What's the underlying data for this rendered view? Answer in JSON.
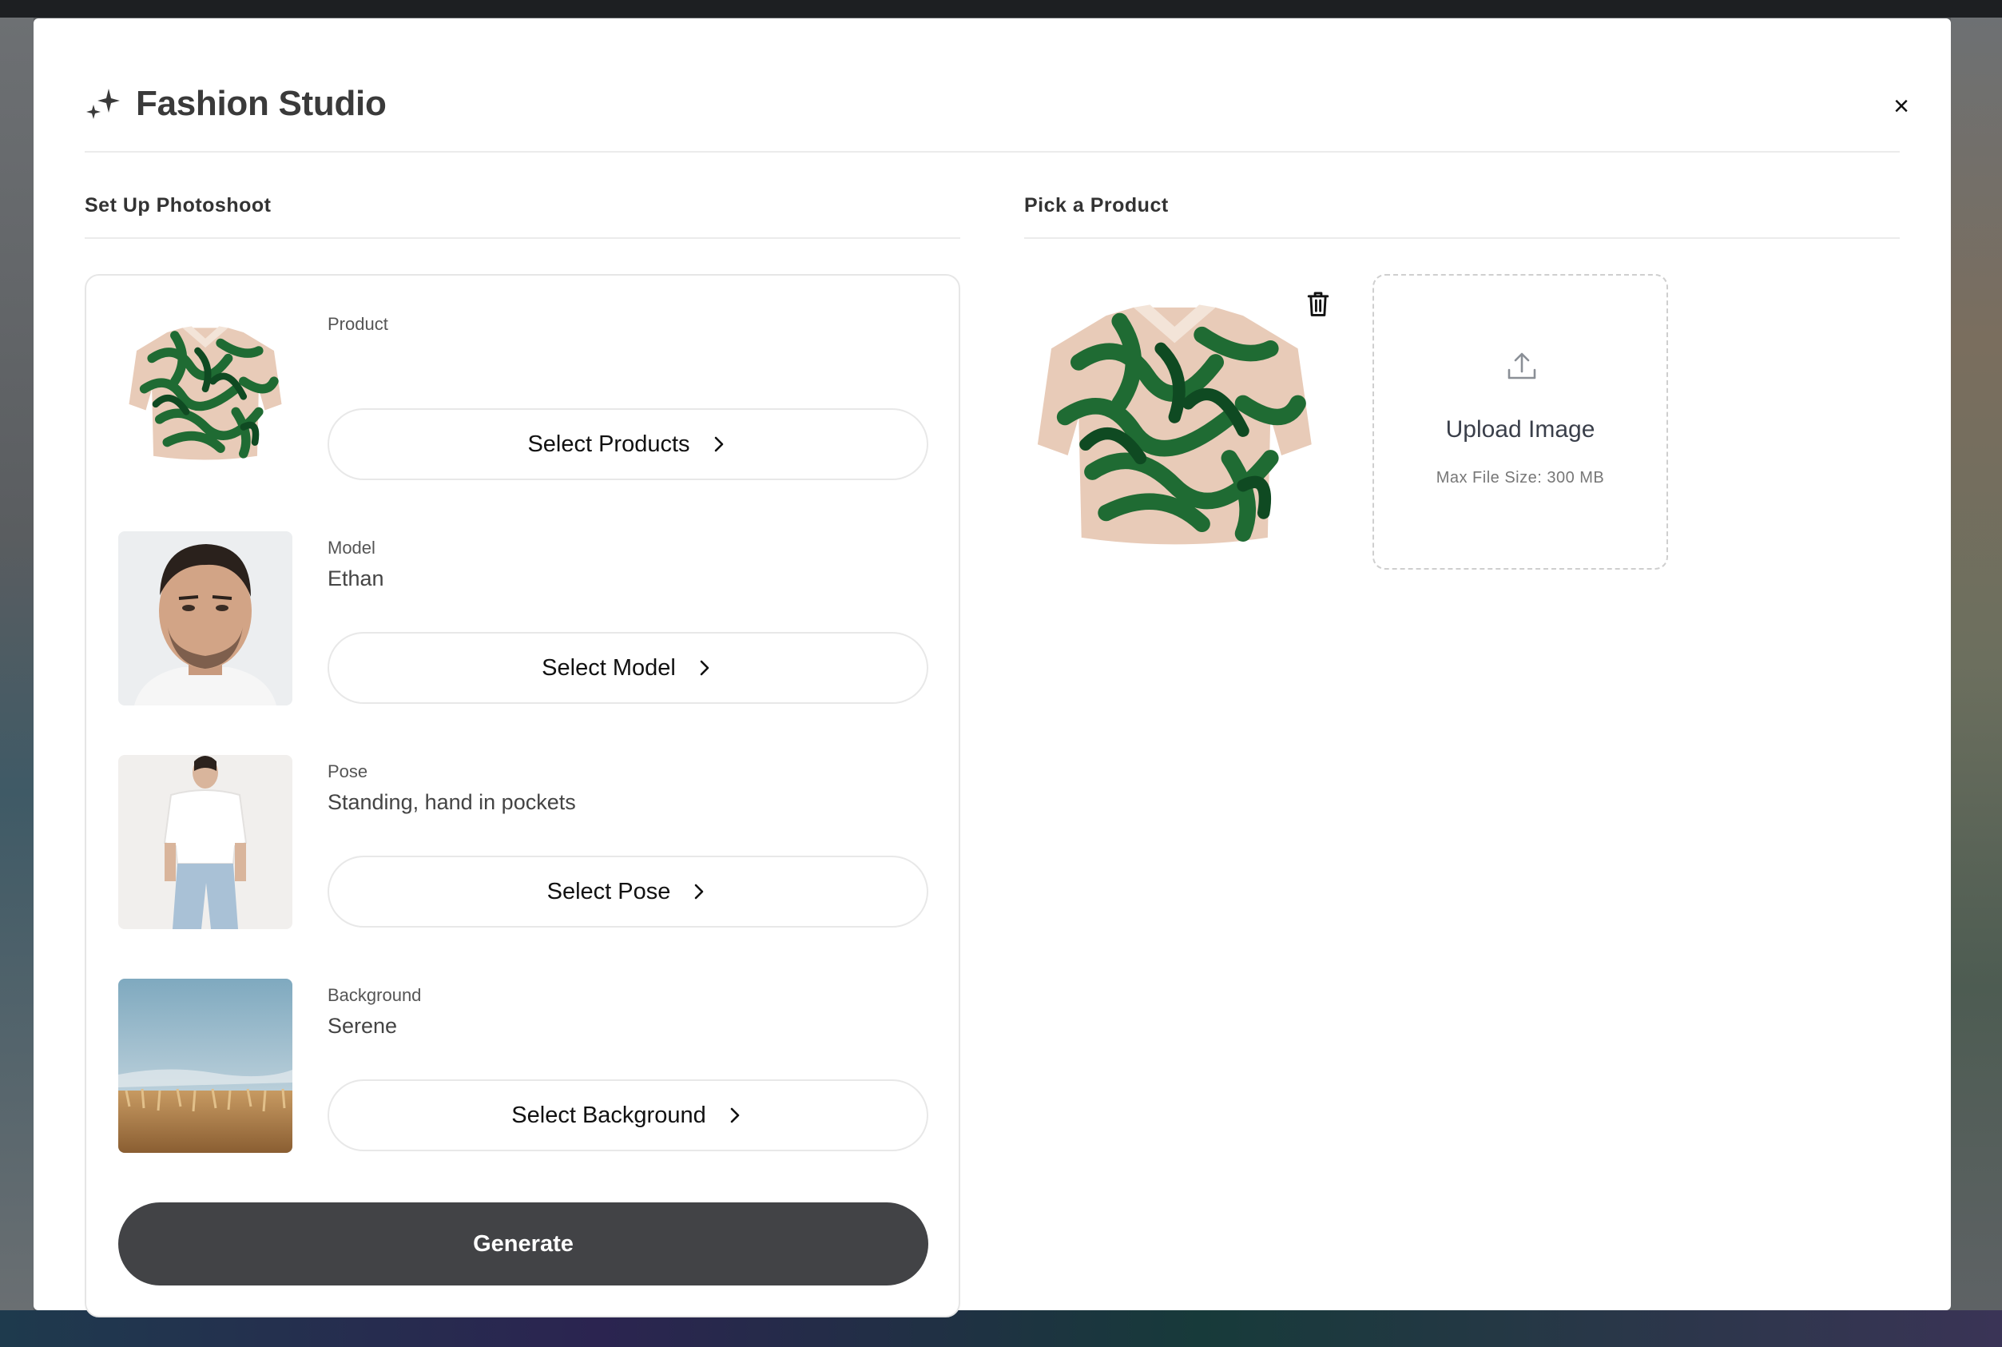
{
  "header": {
    "title": "Fashion Studio",
    "close_label": "×"
  },
  "setup": {
    "title": "Set Up Photoshoot",
    "rows": [
      {
        "label": "Product",
        "value": "",
        "button": "Select Products"
      },
      {
        "label": "Model",
        "value": "Ethan",
        "button": "Select Model"
      },
      {
        "label": "Pose",
        "value": "Standing, hand in pockets",
        "button": "Select Pose"
      },
      {
        "label": "Background",
        "value": "Serene",
        "button": "Select Background"
      }
    ],
    "generate_label": "Generate"
  },
  "picker": {
    "title": "Pick a Product",
    "upload_title": "Upload Image",
    "upload_sub": "Max File Size: 300 MB"
  },
  "icons": {
    "title": "sparkle-icon",
    "close": "close-icon",
    "chevron": "chevron-right-icon",
    "trash": "trash-icon",
    "upload": "upload-icon"
  },
  "colors": {
    "primary_button": "#424346",
    "border": "#e6e6e6",
    "shirt_green": "#1f6b33",
    "shirt_base": "#e8cbb8"
  }
}
